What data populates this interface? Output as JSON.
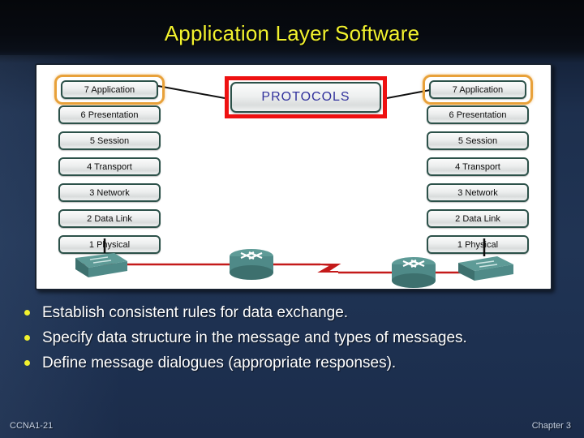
{
  "slide": {
    "title": "Application Layer Software",
    "background_color": "#1d3050",
    "title_color": "#f2f22e"
  },
  "diagram": {
    "panel_background": "#ffffff",
    "left_stack": {
      "name": "osi-layer-stack-left",
      "layers": [
        {
          "label": "7 Application",
          "highlighted": true
        },
        {
          "label": "6 Presentation",
          "highlighted": false
        },
        {
          "label": "5 Session",
          "highlighted": false
        },
        {
          "label": "4 Transport",
          "highlighted": false
        },
        {
          "label": "3 Network",
          "highlighted": false
        },
        {
          "label": "2 Data Link",
          "highlighted": false
        },
        {
          "label": "1 Physical",
          "highlighted": false
        }
      ]
    },
    "right_stack": {
      "name": "osi-layer-stack-right",
      "layers": [
        {
          "label": "7 Application",
          "highlighted": true
        },
        {
          "label": "6 Presentation",
          "highlighted": false
        },
        {
          "label": "5 Session",
          "highlighted": false
        },
        {
          "label": "4 Transport",
          "highlighted": false
        },
        {
          "label": "3 Network",
          "highlighted": false
        },
        {
          "label": "2 Data Link",
          "highlighted": false
        },
        {
          "label": "1 Physical",
          "highlighted": false
        }
      ]
    },
    "protocols_box": {
      "label": "PROTOCOLS",
      "border_color": "#ee1111",
      "text_color": "#31319c"
    },
    "highlight_color": "#e8a13a",
    "layer_border_color": "#2c5149",
    "network": {
      "link_color": "#c41a1a",
      "device_color": "#4f8a88",
      "devices": [
        {
          "type": "switch",
          "name": "switch-left"
        },
        {
          "type": "router",
          "name": "router-left"
        },
        {
          "type": "wan-link",
          "name": "wan-lightning-link"
        },
        {
          "type": "router",
          "name": "router-right"
        },
        {
          "type": "switch",
          "name": "switch-right"
        }
      ]
    }
  },
  "bullets": [
    "Establish consistent rules for data exchange.",
    "Specify data structure in the message and types of messages.",
    "Define message dialogues (appropriate responses)."
  ],
  "footer": {
    "left": "CCNA1-21",
    "right": "Chapter 3"
  }
}
